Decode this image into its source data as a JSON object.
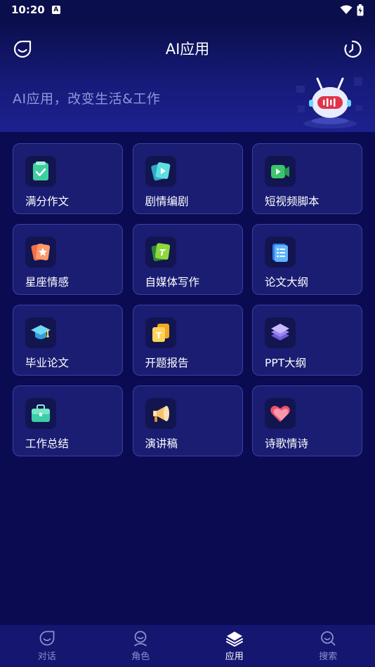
{
  "status_bar": {
    "time": "10:20",
    "a_label": "A"
  },
  "header": {
    "title": "AI应用",
    "slogan": "AI应用，改变生活&工作"
  },
  "apps": [
    {
      "label": "满分作文",
      "icon": "essay-check-icon"
    },
    {
      "label": "剧情编剧",
      "icon": "script-play-icon"
    },
    {
      "label": "短视频脚本",
      "icon": "video-camera-icon"
    },
    {
      "label": "星座情感",
      "icon": "star-card-icon"
    },
    {
      "label": "自媒体写作",
      "icon": "media-text-icon"
    },
    {
      "label": "论文大纲",
      "icon": "list-document-icon"
    },
    {
      "label": "毕业论文",
      "icon": "graduation-cap-icon"
    },
    {
      "label": "开题报告",
      "icon": "report-text-icon"
    },
    {
      "label": "PPT大纲",
      "icon": "layers-icon"
    },
    {
      "label": "工作总结",
      "icon": "briefcase-icon"
    },
    {
      "label": "演讲稿",
      "icon": "megaphone-icon"
    },
    {
      "label": "诗歌情诗",
      "icon": "heart-icon"
    }
  ],
  "nav": {
    "items": [
      {
        "label": "对话",
        "icon": "chat-icon",
        "active": false
      },
      {
        "label": "角色",
        "icon": "person-icon",
        "active": false
      },
      {
        "label": "应用",
        "icon": "layers-icon",
        "active": true
      },
      {
        "label": "搜索",
        "icon": "search-icon",
        "active": false
      }
    ]
  },
  "colors": {
    "background": "#0b0b52",
    "card": "#1a1d72",
    "card_border": "#3a40a8",
    "nav_active": "#ffffff",
    "nav_inactive": "#8b90d0"
  }
}
